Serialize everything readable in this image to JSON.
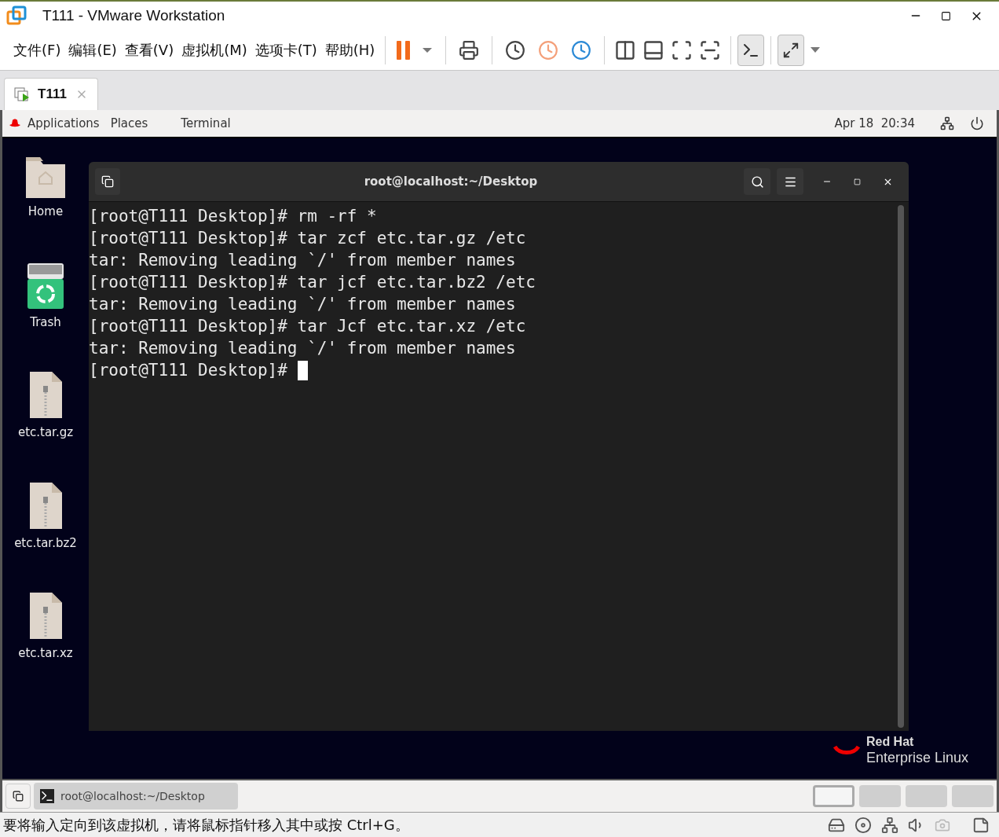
{
  "window": {
    "title": "T111 - VMware Workstation"
  },
  "menu": [
    "文件(F)",
    "编辑(E)",
    "查看(V)",
    "虚拟机(M)",
    "选项卡(T)",
    "帮助(H)"
  ],
  "tabs": [
    {
      "label": "T111",
      "selected": true
    }
  ],
  "gnome_bar": {
    "menus": [
      "Applications",
      "Places",
      "Terminal"
    ],
    "clock": "Apr 18  20:34"
  },
  "desktop_icons": [
    {
      "label": "Home",
      "kind": "folder"
    },
    {
      "label": "Trash",
      "kind": "trash"
    },
    {
      "label": "etc.tar.gz",
      "kind": "archive"
    },
    {
      "label": "etc.tar.bz2",
      "kind": "archive"
    },
    {
      "label": "etc.tar.xz",
      "kind": "archive"
    }
  ],
  "terminal": {
    "title": "root@localhost:~/Desktop",
    "lines": [
      "[root@T111 Desktop]# rm -rf *",
      "[root@T111 Desktop]# tar zcf etc.tar.gz /etc",
      "tar: Removing leading `/' from member names",
      "[root@T111 Desktop]# tar jcf etc.tar.bz2 /etc",
      "tar: Removing leading `/' from member names",
      "[root@T111 Desktop]# tar Jcf etc.tar.xz /etc",
      "tar: Removing leading `/' from member names",
      "[root@T111 Desktop]# "
    ],
    "cursor": true
  },
  "logo": {
    "line_1": "Red Hat",
    "line_2": "Enterprise Linux"
  },
  "taskbar": {
    "items": [
      "root@localhost:~/Desktop"
    ]
  },
  "workspaces": [
    {
      "selected": true
    },
    {
      "selected": false
    },
    {
      "selected": false
    },
    {
      "selected": false
    }
  ],
  "status_bar": "要将输入定向到该虚拟机，请将鼠标指针移入其中或按 Ctrl+G。"
}
